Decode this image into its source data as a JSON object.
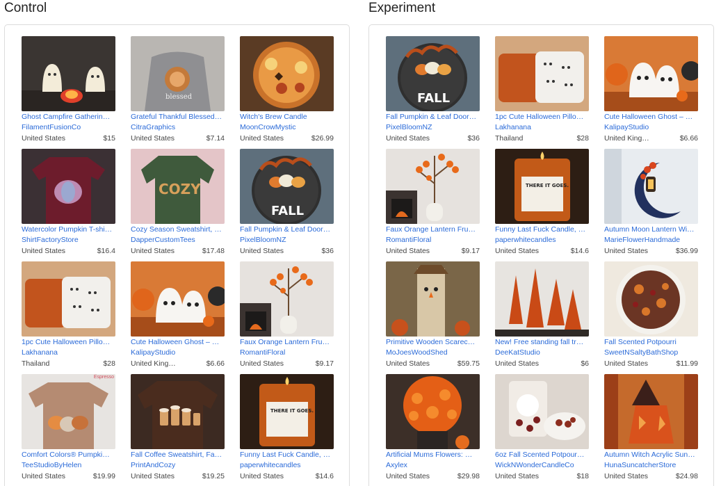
{
  "control": {
    "title": "Control",
    "items": [
      {
        "title": "Ghost Campfire Gatherin…",
        "shop": "FilamentFusionCo",
        "location": "United States",
        "price": "$15",
        "icon": "ghost-campfire-image"
      },
      {
        "title": "Grateful Thankful Blessed…",
        "shop": "CitraGraphics",
        "location": "United States",
        "price": "$7.14",
        "icon": "blessed-sweatshirt-image"
      },
      {
        "title": "Witch's Brew Candle",
        "shop": "MoonCrowMystic",
        "location": "United States",
        "price": "$26.99",
        "icon": "orange-candle-image"
      },
      {
        "title": "Watercolor Pumpkin T-shi…",
        "shop": "ShirtFactoryStore",
        "location": "United States",
        "price": "$16.4",
        "icon": "pumpkin-tshirt-image"
      },
      {
        "title": "Cozy Season Sweatshirt, …",
        "shop": "DapperCustomTees",
        "location": "United States",
        "price": "$17.48",
        "icon": "cozy-sweatshirt-image"
      },
      {
        "title": "Fall Pumpkin & Leaf Door…",
        "shop": "PixelBloomNZ",
        "location": "United States",
        "price": "$36",
        "icon": "door-sign-image"
      },
      {
        "title": "1pc Cute Halloween Pillo…",
        "shop": "Lakhanana",
        "location": "Thailand",
        "price": "$28",
        "icon": "halloween-pillow-image"
      },
      {
        "title": "Cute Halloween Ghost – …",
        "shop": "KalipayStudio",
        "location": "United King…",
        "price": "$6.66",
        "icon": "ghost-figurines-image"
      },
      {
        "title": "Faux Orange Lantern Fru…",
        "shop": "RomantiFloral",
        "location": "United States",
        "price": "$9.17",
        "icon": "lantern-fruit-image"
      },
      {
        "title": "Comfort Colors® Pumpki…",
        "shop": "TeeStudioByHelen",
        "location": "United States",
        "price": "$19.99",
        "icon": "pumpkin-shirt-image",
        "overlay": "Espresso"
      },
      {
        "title": "Fall Coffee Sweatshirt, Fa…",
        "shop": "PrintAndCozy",
        "location": "United States",
        "price": "$19.25",
        "icon": "coffee-sweatshirt-image"
      },
      {
        "title": "Funny Last Fuck Candle, …",
        "shop": "paperwhitecandles",
        "location": "United States",
        "price": "$14.6",
        "icon": "funny-candle-image"
      }
    ]
  },
  "experiment": {
    "title": "Experiment",
    "items": [
      {
        "title": "Fall Pumpkin & Leaf Door…",
        "shop": "PixelBloomNZ",
        "location": "United States",
        "price": "$36",
        "icon": "door-sign-image"
      },
      {
        "title": "1pc Cute Halloween Pillo…",
        "shop": "Lakhanana",
        "location": "Thailand",
        "price": "$28",
        "icon": "halloween-pillow-image"
      },
      {
        "title": "Cute Halloween Ghost – …",
        "shop": "KalipayStudio",
        "location": "United King…",
        "price": "$6.66",
        "icon": "ghost-figurines-image"
      },
      {
        "title": "Faux Orange Lantern Fru…",
        "shop": "RomantiFloral",
        "location": "United States",
        "price": "$9.17",
        "icon": "lantern-fruit-image"
      },
      {
        "title": "Funny Last Fuck Candle, …",
        "shop": "paperwhitecandles",
        "location": "United States",
        "price": "$14.6",
        "icon": "funny-candle-image"
      },
      {
        "title": "Autumn Moon Lantern Wi…",
        "shop": "MarieFlowerHandmade",
        "location": "United States",
        "price": "$36.99",
        "icon": "moon-lantern-image"
      },
      {
        "title": "Primitive Wooden Scarec…",
        "shop": "MoJoesWoodShed",
        "location": "United States",
        "price": "$59.75",
        "icon": "wooden-scarecrow-image"
      },
      {
        "title": "New! Free standing fall tr…",
        "shop": "DeeKatStudio",
        "location": "United States",
        "price": "$6",
        "icon": "fall-trees-image"
      },
      {
        "title": "Fall Scented Potpourri",
        "shop": "SweetNSaltyBathShop",
        "location": "United States",
        "price": "$11.99",
        "icon": "potpourri-bowl-image"
      },
      {
        "title": "Artificial Mums Flowers: …",
        "shop": "Axylex",
        "location": "United States",
        "price": "$29.98",
        "icon": "mums-flowers-image"
      },
      {
        "title": "6oz Fall Scented Potpour…",
        "shop": "WickNWonderCandleCo",
        "location": "United States",
        "price": "$18",
        "icon": "potpourri-bag-image"
      },
      {
        "title": "Autumn Witch Acrylic Sun…",
        "shop": "HunaSuncatcherStore",
        "location": "United States",
        "price": "$24.98",
        "icon": "witch-suncatcher-image"
      }
    ]
  },
  "colors": {
    "link": "#2a6ad8",
    "border": "#dcdcdc"
  }
}
